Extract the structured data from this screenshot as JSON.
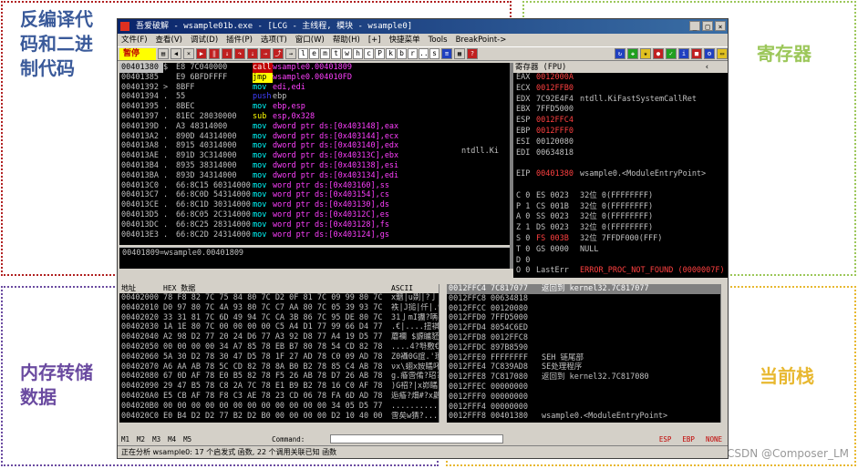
{
  "callouts": {
    "code": "反编译代码和二进制代码",
    "registers": "寄存器",
    "memory": "内存转储数据",
    "stack": "当前栈"
  },
  "watermark": "CSDN @Composer_LM",
  "window": {
    "title": "吾爱破解 - wsample01b.exe - [LCG - 主线程, 模块 - wsample0]",
    "menu": [
      "文件(F)",
      "查看(V)",
      "调试(D)",
      "插件(P)",
      "选项(T)",
      "窗口(W)",
      "帮助(H)",
      "[+]",
      "快捷菜单",
      "Tools",
      "BreakPoint->"
    ],
    "status": "暂停",
    "letters": [
      "l",
      "e",
      "m",
      "t",
      "w",
      "h",
      "c",
      "P",
      "k",
      "b",
      "r",
      "...",
      "s"
    ]
  },
  "cpu": {
    "rows": [
      {
        "addr": "00401380",
        "mark": "$",
        "hex": "E8 7C040000",
        "mn": "call",
        "op": "wsample0.00401809",
        "cls": "sel"
      },
      {
        "addr": "00401385",
        "mark": "",
        "hex": "E9 6BFDFFFF",
        "mn": "jmp",
        "op": "wsample0.004010FD",
        "cls": "jmp"
      },
      {
        "addr": "00401392",
        "mark": ">",
        "hex": "8BFF",
        "mn": "mov",
        "op": "edi,edi",
        "cls": "mov"
      },
      {
        "addr": "00401394",
        "mark": ".",
        "hex": "55",
        "mn": "push",
        "op": "ebp",
        "cls": "push"
      },
      {
        "addr": "00401395",
        "mark": ".",
        "hex": "8BEC",
        "mn": "mov",
        "op": "ebp,esp",
        "cls": "mov"
      },
      {
        "addr": "00401397",
        "mark": ".",
        "hex": "81EC 28030000",
        "mn": "sub",
        "op": "esp,0x328",
        "cls": "sub"
      },
      {
        "addr": "0040139D",
        "mark": ".",
        "hex": "A3 48314000",
        "mn": "mov",
        "op": "dword ptr ds:[0x403148],eax",
        "cls": "mov"
      },
      {
        "addr": "004013A2",
        "mark": ".",
        "hex": "890D 44314000",
        "mn": "mov",
        "op": "dword ptr ds:[0x403144],ecx",
        "cls": "mov"
      },
      {
        "addr": "004013A8",
        "mark": ".",
        "hex": "8915 40314000",
        "mn": "mov",
        "op": "dword ptr ds:[0x403140],edx",
        "cls": "mov"
      },
      {
        "addr": "004013AE",
        "mark": ".",
        "hex": "891D 3C314000",
        "mn": "mov",
        "op": "dword ptr ds:[0x40313C],ebx",
        "cls": "mov"
      },
      {
        "addr": "004013B4",
        "mark": ".",
        "hex": "8935 38314000",
        "mn": "mov",
        "op": "dword ptr ds:[0x403138],esi",
        "cls": "mov"
      },
      {
        "addr": "004013BA",
        "mark": ".",
        "hex": "893D 34314000",
        "mn": "mov",
        "op": "dword ptr ds:[0x403134],edi",
        "cls": "mov"
      },
      {
        "addr": "004013C0",
        "mark": ".",
        "hex": "66:8C15 60314000",
        "mn": "mov",
        "op": "word ptr ds:[0x403160],ss",
        "cls": "mov"
      },
      {
        "addr": "004013C7",
        "mark": ".",
        "hex": "66:8C0D 54314000",
        "mn": "mov",
        "op": "word ptr ds:[0x403154],cs",
        "cls": "mov"
      },
      {
        "addr": "004013CE",
        "mark": ".",
        "hex": "66:8C1D 30314000",
        "mn": "mov",
        "op": "word ptr ds:[0x403130],ds",
        "cls": "mov"
      },
      {
        "addr": "004013D5",
        "mark": ".",
        "hex": "66:8C05 2C314000",
        "mn": "mov",
        "op": "word ptr ds:[0x40312C],es",
        "cls": "mov"
      },
      {
        "addr": "004013DC",
        "mark": ".",
        "hex": "66:8C25 28314000",
        "mn": "mov",
        "op": "word ptr ds:[0x403128],fs",
        "cls": "mov"
      },
      {
        "addr": "004013E3",
        "mark": ".",
        "hex": "66:8C2D 24314000",
        "mn": "mov",
        "op": "word ptr ds:[0x403124],gs",
        "cls": "mov"
      }
    ],
    "info": "00401809=wsample0.00401809",
    "near_label": "ntdll.Ki"
  },
  "registers": {
    "header": "寄存器 (FPU)",
    "rows": [
      {
        "n": "EAX",
        "v": "0012000A",
        "c": "",
        "cv": ""
      },
      {
        "n": "ECX",
        "v": "0012FFB0",
        "c": "",
        "cv": ""
      },
      {
        "n": "EDX",
        "v": "7C92E4F4",
        "c": "ntdll.KiFastSystemCallRet",
        "cv": "w"
      },
      {
        "n": "EBX",
        "v": "7FFD5000",
        "c": "",
        "cv": "w"
      },
      {
        "n": "ESP",
        "v": "0012FFC4",
        "c": "",
        "cv": ""
      },
      {
        "n": "EBP",
        "v": "0012FFF0",
        "c": "",
        "cv": ""
      },
      {
        "n": "ESI",
        "v": "00120080",
        "c": "",
        "cv": "w"
      },
      {
        "n": "EDI",
        "v": "00634818",
        "c": "",
        "cv": "w"
      },
      {
        "n": "",
        "v": "",
        "c": "",
        "cv": ""
      },
      {
        "n": "EIP",
        "v": "00401380",
        "c": "wsample0.<ModuleEntryPoint>",
        "cv": ""
      },
      {
        "n": "",
        "v": "",
        "c": "",
        "cv": ""
      },
      {
        "n": "C 0",
        "v": "ES 0023",
        "c": "32位 0(FFFFFFFF)",
        "cv": "w"
      },
      {
        "n": "P 1",
        "v": "CS 001B",
        "c": "32位 0(FFFFFFFF)",
        "cv": "w"
      },
      {
        "n": "A 0",
        "v": "SS 0023",
        "c": "32位 0(FFFFFFFF)",
        "cv": "w"
      },
      {
        "n": "Z 1",
        "v": "DS 0023",
        "c": "32位 0(FFFFFFFF)",
        "cv": "w"
      },
      {
        "n": "S 0",
        "v": "FS 003B",
        "c": "32位 7FFDF000(FFF)",
        "cv": ""
      },
      {
        "n": "T 0",
        "v": "GS 0000",
        "c": "NULL",
        "cv": "w"
      },
      {
        "n": "D 0",
        "v": "",
        "c": "",
        "cv": ""
      },
      {
        "n": "O 0",
        "v": "LastErr",
        "c": "ERROR_PROC_NOT_FOUND (0000007F)",
        "cv": "w",
        "err": true
      },
      {
        "n": "",
        "v": "",
        "c": "",
        "cv": ""
      },
      {
        "n": "EFL",
        "v": "00000246",
        "c": "(NO,NB,E,BE,NS,PE,GE,LE)",
        "cv": ""
      }
    ]
  },
  "dump": {
    "headers": [
      "地址",
      "HEX 数据",
      "ASCII"
    ],
    "rows": [
      {
        "a": "00402000",
        "h": "78 F8 82 7C 75 84 80 7C D2 0F 81 7C 09 99 80 7C",
        "s": "x魑|u剟|?亅.檧|"
      },
      {
        "a": "00402010",
        "h": "D0 97 80 7C 4A 93 80 7C C7 AA 80 7C 05 39 93 7C",
        "s": "袟|J搥|仟|.9搢"
      },
      {
        "a": "00402020",
        "h": "33 31 81 7C 6D 49 94 7C CA 3B 86 7C 95 DE 80 7C",
        "s": "31亅mI攟?唡曓|"
      },
      {
        "a": "00402030",
        "h": "1A 1E 80 7C 00 00 00 00 C5 A4 D1 77 99 66 D4 77",
        "s": ".€|....扭褀檉詗"
      },
      {
        "a": "00402040",
        "h": "A2 98 D2 77 20 24 D6 77 A3 92 D8 77 A4 19 D5 77",
        "s": "蘑襴 $謜矑豾?誻"
      },
      {
        "a": "00402050",
        "h": "00 00 00 00 34 A7 85 78 EB B7 80 78 54 CD 82 78",
        "s": "....4?厁敷€xT蛡x"
      },
      {
        "a": "00402060",
        "h": "5A 30 D2 78 30 47 D5 78 1F 27 AD 78 C0 09 AD 78",
        "s": "Z0襵0G誼.'瓁?瓁"
      },
      {
        "a": "00402070",
        "h": "A6 AA AB 78 5C CD 82 78 8A B0 B2 78 85 C4 AB 78",
        "s": "νx\\蛡x姲瞲吥玿"
      },
      {
        "a": "00402080",
        "h": "67 0D AF 78 E0 B5 82 78 F5 26 AB 78 D7 26 AB 78",
        "s": "g.痻啻倄?玿?玿"
      },
      {
        "a": "00402090",
        "h": "29 47 B5 78 C8 2A 7C 78 E1 B9 B2 78 16 C0 AF 78",
        "s": ")G祒?|x峁瞲.拉x"
      },
      {
        "a": "004020A0",
        "h": "E5 CB AF 78 F8 C3 AE 78 23 CD 06 78 FA 6D AD 78",
        "s": "逅痻?畑#?x鷐瓁"
      },
      {
        "a": "004020B0",
        "h": "00 00 00 00 00 00 00 00 00 00 00 00 34 05 D5 77",
        "s": "............4.誻"
      },
      {
        "a": "004020C0",
        "h": "E0 B4 D2 D2 77 B2 D2 B0 00 00 00 00 D2 10 40 00",
        "s": "啻矣w猜?....?@."
      }
    ]
  },
  "stack": {
    "rows": [
      {
        "a": "0012FFC4",
        "v": "7C817077",
        "c": "返回到 kernel32.7C817077",
        "cls": "sel"
      },
      {
        "a": "0012FFC8",
        "v": "00634818",
        "c": ""
      },
      {
        "a": "0012FFCC",
        "v": "00120080",
        "c": ""
      },
      {
        "a": "0012FFD0",
        "v": "7FFD5000",
        "c": ""
      },
      {
        "a": "0012FFD4",
        "v": "8054C6ED",
        "c": ""
      },
      {
        "a": "0012FFD8",
        "v": "0012FFC8",
        "c": ""
      },
      {
        "a": "0012FFDC",
        "v": "897B8590",
        "c": ""
      },
      {
        "a": "0012FFE0",
        "v": "FFFFFFFF",
        "c": "SEH 链尾部"
      },
      {
        "a": "0012FFE4",
        "v": "7C839AD8",
        "c": "SE处理程序"
      },
      {
        "a": "0012FFE8",
        "v": "7C817080",
        "c": "返回到 kernel32.7C817080"
      },
      {
        "a": "0012FFEC",
        "v": "00000000",
        "c": ""
      },
      {
        "a": "0012FFF0",
        "v": "00000000",
        "c": ""
      },
      {
        "a": "0012FFF4",
        "v": "00000000",
        "c": ""
      },
      {
        "a": "0012FFF8",
        "v": "00401380",
        "c": "wsample0.<ModuleEntryPoint>"
      }
    ]
  },
  "bottom": {
    "tabs": [
      "M1",
      "M2",
      "M3",
      "M4",
      "M5"
    ],
    "command_label": "Command:",
    "right_btns": [
      "ESP",
      "EBP",
      "NONE"
    ]
  },
  "statusbar": "正在分析 wsample0: 17 个启发式 函数, 22 个调用关联已知 函数"
}
